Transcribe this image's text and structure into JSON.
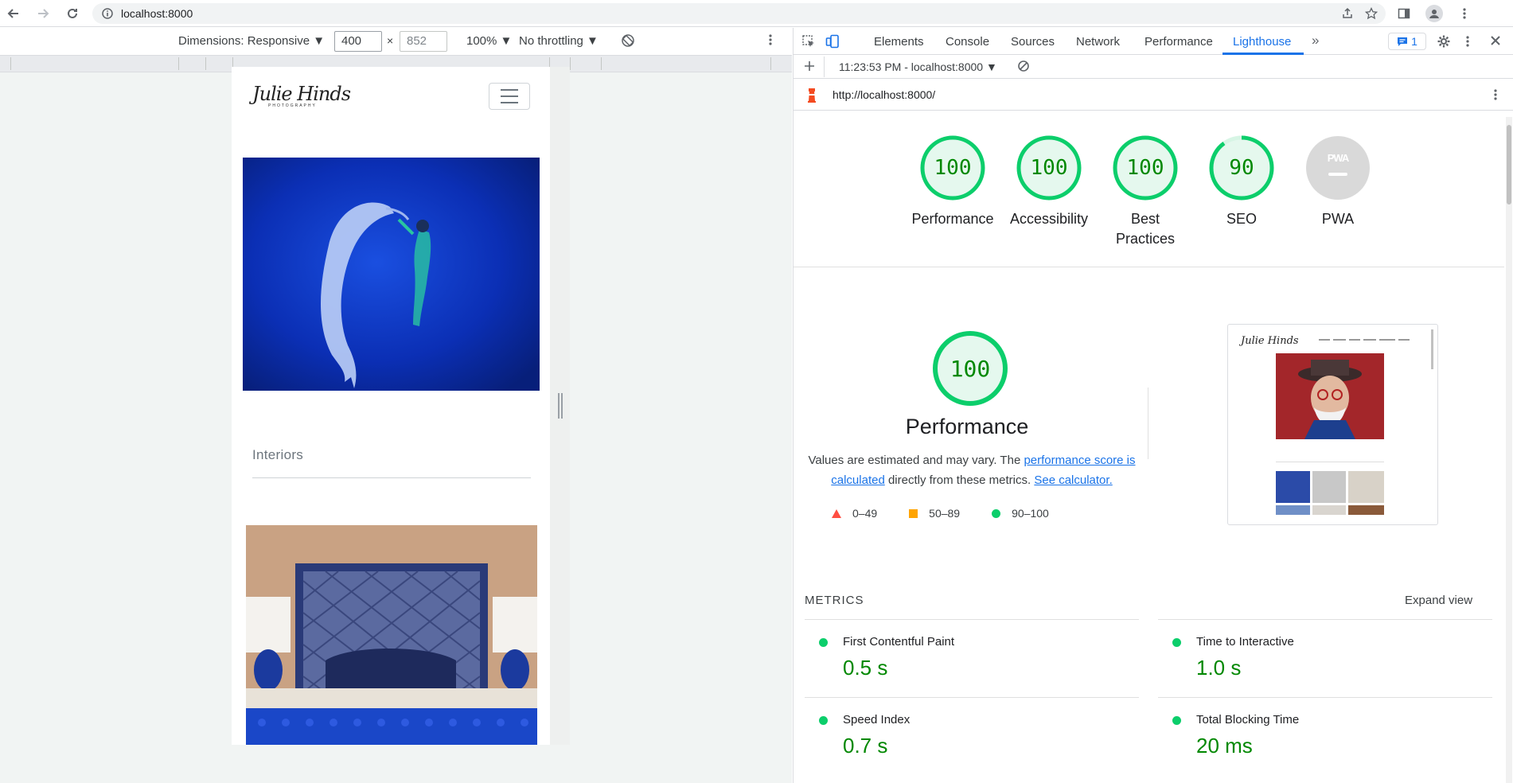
{
  "browser": {
    "url": "localhost:8000"
  },
  "device_toolbar": {
    "dimensions_label": "Dimensions: Responsive ▼",
    "width": "400",
    "height": "852",
    "zoom": "100% ▼",
    "throttling": "No throttling ▼"
  },
  "site": {
    "logo": "Julie Hinds",
    "logo_sub": "PHOTOGRAPHY",
    "section_title": "Interiors"
  },
  "devtools": {
    "tabs": [
      "Elements",
      "Console",
      "Sources",
      "Network",
      "Performance",
      "Lighthouse"
    ],
    "active_tab": "Lighthouse",
    "issues_count": "1",
    "report_time": "11:23:53 PM - localhost:8000 ▼",
    "report_url": "http://localhost:8000/"
  },
  "lighthouse": {
    "gauges": [
      {
        "label": "Performance",
        "score": "100",
        "value": 100
      },
      {
        "label": "Accessibility",
        "score": "100",
        "value": 100
      },
      {
        "label": "Best Practices",
        "score": "100",
        "value": 100
      },
      {
        "label": "SEO",
        "score": "90",
        "value": 90
      },
      {
        "label": "PWA",
        "score": "PWA",
        "value": 0
      }
    ],
    "perf": {
      "score": "100",
      "title": "Performance",
      "desc_1": "Values are estimated and may vary. The ",
      "link_1": "performance score is calculated",
      "desc_2": " directly from these metrics. ",
      "link_2": "See calculator."
    },
    "legend": [
      "0–49",
      "50–89",
      "90–100"
    ],
    "metrics_heading": "METRICS",
    "expand_view": "Expand view",
    "metrics": [
      {
        "label": "First Contentful Paint",
        "value": "0.5 s"
      },
      {
        "label": "Time to Interactive",
        "value": "1.0 s"
      },
      {
        "label": "Speed Index",
        "value": "0.7 s"
      },
      {
        "label": "Total Blocking Time",
        "value": "20 ms"
      }
    ]
  },
  "colors": {
    "pass_green": "#0cce6b",
    "pass_text": "#008800",
    "pass_fill": "#e5f8ee",
    "average_orange": "#ffa400",
    "fail_red": "#ff4e42",
    "accent_blue": "#1a73e8"
  }
}
